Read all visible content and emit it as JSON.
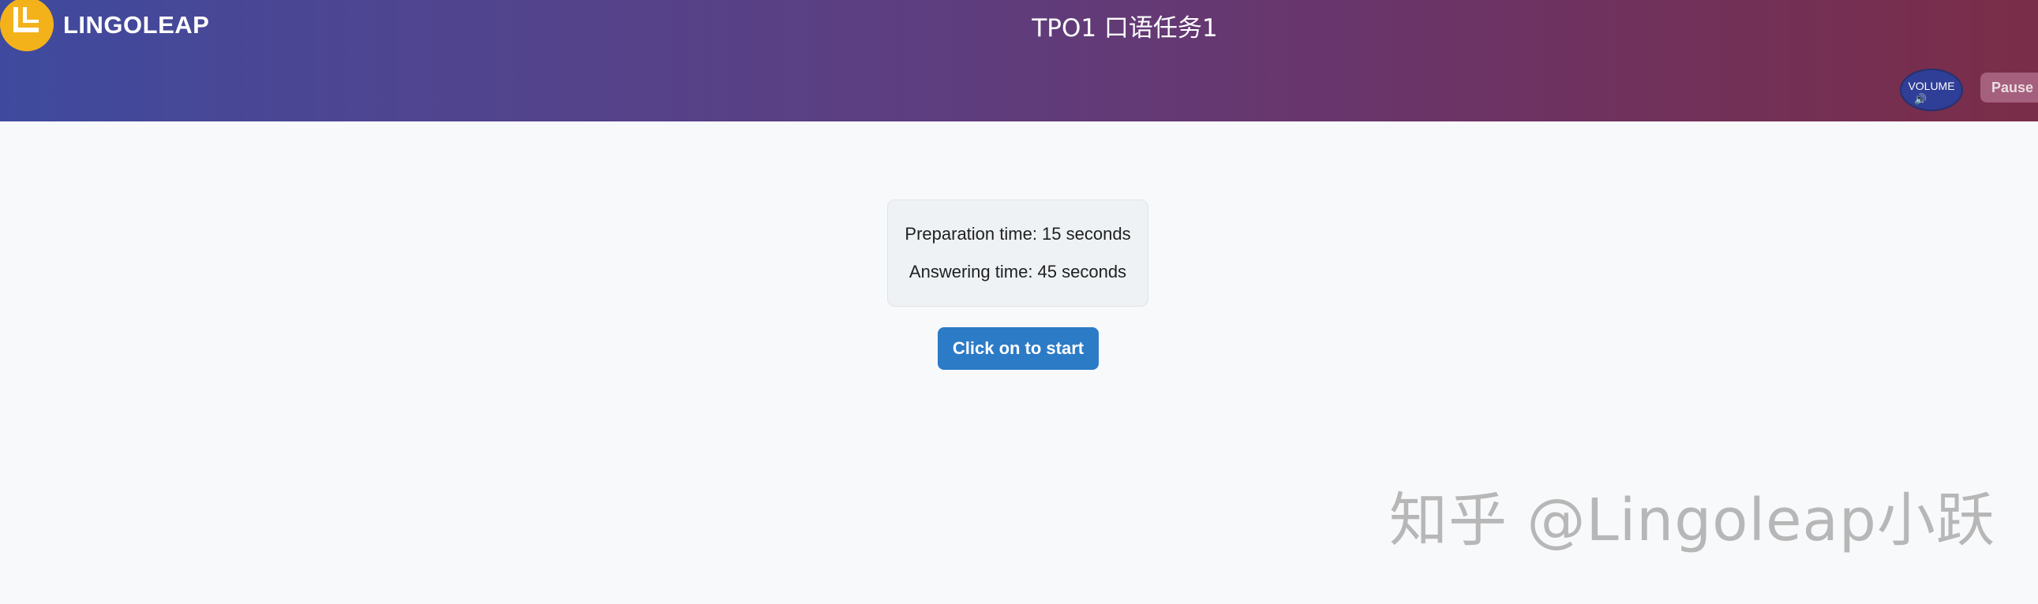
{
  "header": {
    "logo_text": "LINGOLEAP",
    "title": "TPO1 口语任务1",
    "volume_label": "VOLUME",
    "volume_icon": "speaker-icon",
    "pause_label": "Pause"
  },
  "main": {
    "preparation_text": "Preparation time: 15 seconds",
    "answering_text": "Answering time: 45 seconds",
    "start_label": "Click on to start"
  },
  "watermark": "知乎 @Lingoleap小跃",
  "colors": {
    "logo_badge": "#f4b21a",
    "start_button": "#2c7bc7",
    "volume_button": "#2f3e96"
  }
}
